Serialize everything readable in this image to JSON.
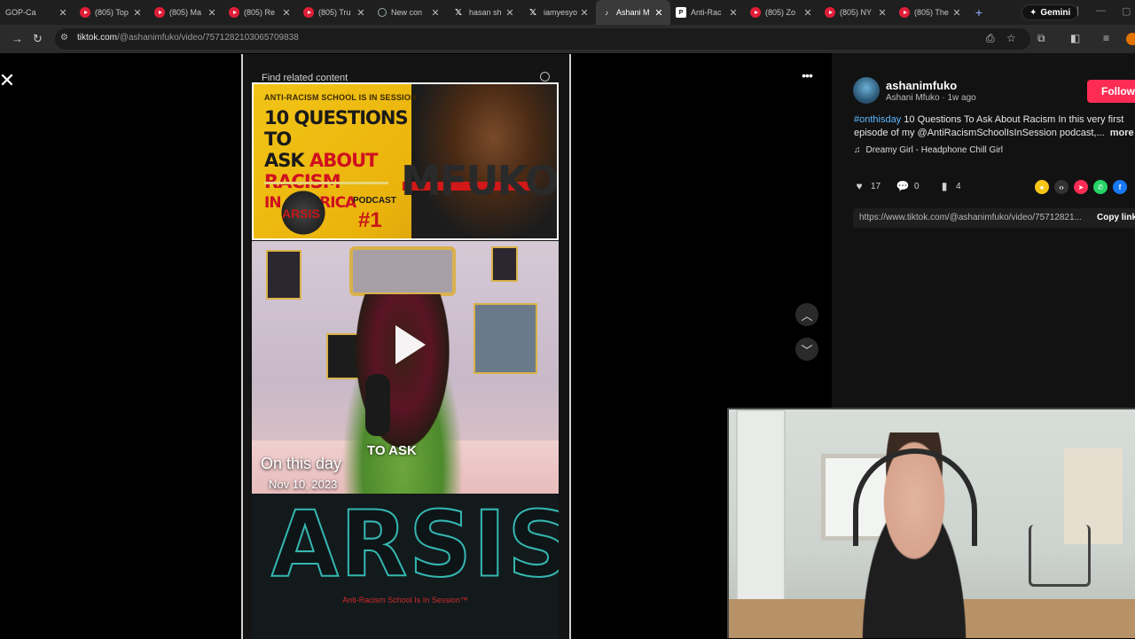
{
  "browser": {
    "tabs": [
      {
        "favicon": "none",
        "title": "GOP-Ca"
      },
      {
        "favicon": "youtube-icon",
        "title": "(805) Top"
      },
      {
        "favicon": "youtube-icon",
        "title": "(805) Ma"
      },
      {
        "favicon": "youtube-icon",
        "title": "(805) Re"
      },
      {
        "favicon": "youtube-icon",
        "title": "(805) Tru"
      },
      {
        "favicon": "circle-icon",
        "title": "New con"
      },
      {
        "favicon": "x-icon",
        "title": "hasan sh"
      },
      {
        "favicon": "x-icon",
        "title": "iamyesyo"
      },
      {
        "favicon": "tiktok-icon",
        "title": "Ashani M",
        "active": true
      },
      {
        "favicon": "patreon-icon",
        "title": "Anti-Rac"
      },
      {
        "favicon": "youtube-icon",
        "title": "(805) Zo"
      },
      {
        "favicon": "youtube-icon",
        "title": "(805) NY"
      },
      {
        "favicon": "youtube-icon",
        "title": "(805) The"
      }
    ],
    "new_tab": "+",
    "gemini_label": "Gemini",
    "url_host": "tiktok.com",
    "url_path": "/@ashanimfuko/video/7571282103065709838"
  },
  "video": {
    "search_placeholder": "Find related content",
    "thumb_kicker": "ANTI-RACISM SCHOOL IS IN SESSION",
    "thumb_headline_1": "10 QUESTIONS TO",
    "thumb_headline_2a": "ASK ",
    "thumb_headline_2b": "ABOUT RACISM",
    "thumb_headline_3": "IN AMERICA",
    "thumb_bigname": "MFUKO",
    "thumb_logo": "ARSIS",
    "thumb_podcast": "PODCAST",
    "thumb_number": "#1",
    "caption_to_ask": "TO ASK",
    "on_this_day": "On this day",
    "on_this_day_date": "Nov 10, 2023",
    "bottom_logo": "ARSIS",
    "bottom_tagline": "Anti-Racism School Is In Session™"
  },
  "post": {
    "username": "ashanimfuko",
    "display_name": "Ashani Mfuko",
    "time_ago": "1w ago",
    "follow_label": "Follow",
    "hashtag": "#onthisday",
    "desc_line1": " 10 Questions To Ask About Racism In this very first",
    "desc_line2": "episode of my @AntiRacismSchoolIsInSession podcast,...",
    "more_label": "more",
    "sound": "Dreamy Girl - Headphone Chill Girl",
    "likes": "17",
    "comments": "0",
    "saves": "4",
    "link": "https://www.tiktok.com/@ashanimfuko/video/75712821...",
    "copy_link_label": "Copy link"
  },
  "colors": {
    "accent_follow": "#fe2c55",
    "hashtag": "#5eb8ff",
    "arsis_teal": "#34b6b0"
  }
}
